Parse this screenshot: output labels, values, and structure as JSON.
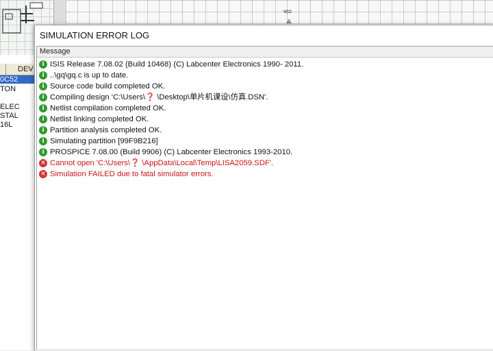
{
  "background_app": {
    "device_panel_header": "DEV",
    "device_items": [
      {
        "label": "0C52",
        "selected": true
      },
      {
        "label": "TON",
        "selected": false
      },
      {
        "label": "ELEC",
        "selected": false
      },
      {
        "label": "STAL",
        "selected": false
      },
      {
        "label": "16L",
        "selected": false
      }
    ],
    "canvas_label": "vcc"
  },
  "window": {
    "title": "SIMULATION ERROR LOG",
    "column_header": "Message"
  },
  "messages": [
    {
      "type": "info",
      "icon": "info-icon",
      "text": "ISIS Release 7.08.02 (Build 10468) (C) Labcenter Electronics 1990- 2011."
    },
    {
      "type": "info",
      "icon": "info-icon",
      "text": "..\\gq\\gq.c is up to date."
    },
    {
      "type": "info",
      "icon": "info-icon",
      "text": "Source code build completed OK."
    },
    {
      "type": "info",
      "icon": "info-icon",
      "text": "Compiling design 'C:\\Users\\❓ \\Desktop\\单片机课设\\仿真.DSN'."
    },
    {
      "type": "info",
      "icon": "info-icon",
      "text": "Netlist compilation completed OK."
    },
    {
      "type": "info",
      "icon": "info-icon",
      "text": "Netlist linking completed OK."
    },
    {
      "type": "info",
      "icon": "info-icon",
      "text": "Partition analysis completed OK."
    },
    {
      "type": "info",
      "icon": "info-icon",
      "text": "Simulating partition [99F9B216]"
    },
    {
      "type": "info",
      "icon": "info-icon",
      "text": "PROSPICE 7.08.00 (Build 9906) (C) Labcenter Electronics 1993-2010."
    },
    {
      "type": "err",
      "icon": "error-icon",
      "text": "Cannot open 'C:\\Users\\❓ \\AppData\\Local\\Temp\\LISA2059.SDF'."
    },
    {
      "type": "err",
      "icon": "error-icon",
      "text": "Simulation FAILED due to fatal simulator errors."
    }
  ],
  "colors": {
    "info_icon": "#2f9a2c",
    "error_icon": "#d13434",
    "error_text": "#cc1212",
    "selection": "#316ac5"
  }
}
